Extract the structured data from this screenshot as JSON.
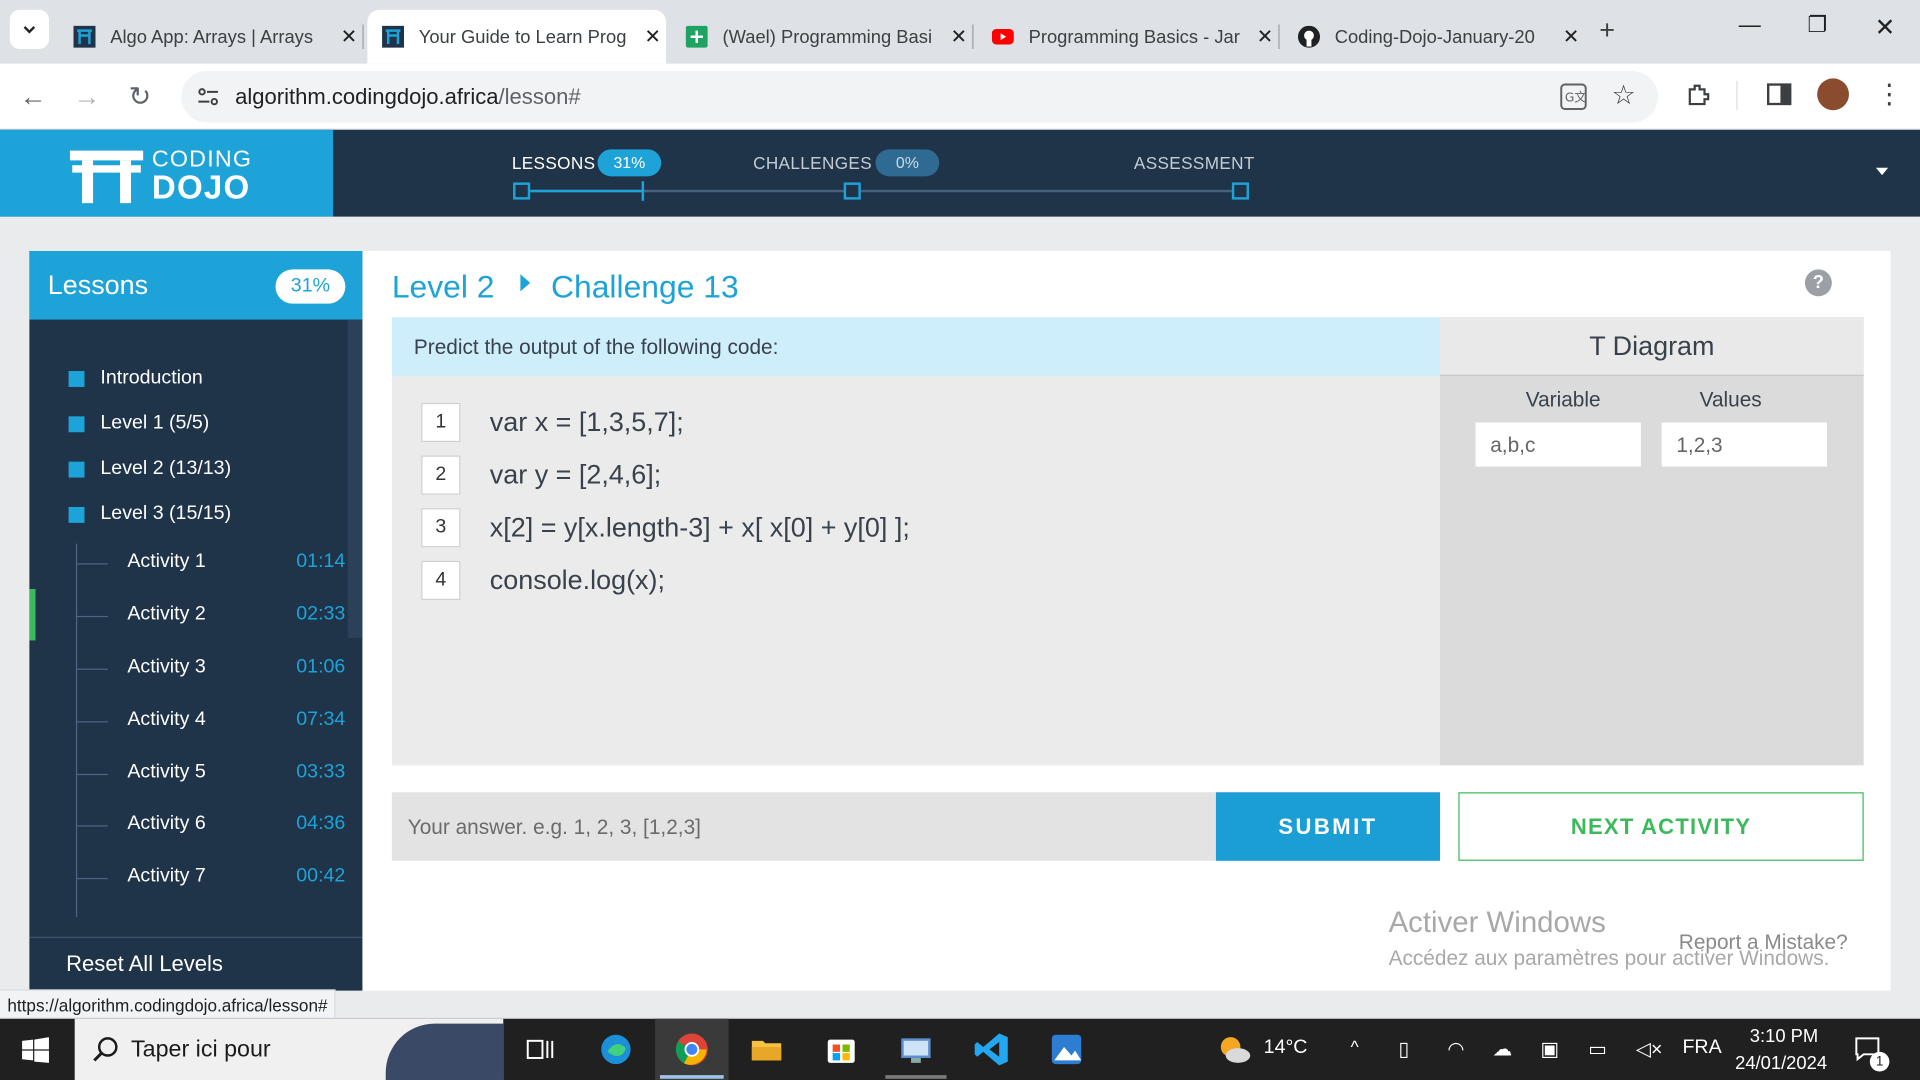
{
  "browser": {
    "tabs": [
      {
        "title": "Algo App: Arrays | Arrays",
        "icon": "coding-dojo-favicon"
      },
      {
        "title": "Your Guide to Learn Prog",
        "icon": "coding-dojo-favicon"
      },
      {
        "title": "(Wael) Programming Basi",
        "icon": "google-sheets-icon"
      },
      {
        "title": "Programming Basics - Jar",
        "icon": "youtube-icon"
      },
      {
        "title": "Coding-Dojo-January-20",
        "icon": "github-icon"
      }
    ],
    "url_host": "algorithm.codingdojo.africa",
    "url_path": "/lesson#",
    "status_url": "https://algorithm.codingdojo.africa/lesson#"
  },
  "site": {
    "logo_top": "CODING",
    "logo_bottom": "DOJO",
    "progress": {
      "lessons_label": "LESSONS",
      "lessons_pct": "31%",
      "challenges_label": "CHALLENGES",
      "challenges_pct": "0%",
      "assessment_label": "ASSESSMENT",
      "lessons_fill_fraction": 0.31
    }
  },
  "sidebar": {
    "title": "Lessons",
    "pct": "31%",
    "sections": [
      {
        "label": "Introduction"
      },
      {
        "label": "Level 1 (5/5)"
      },
      {
        "label": "Level 2 (13/13)"
      },
      {
        "label": "Level 3 (15/15)"
      }
    ],
    "activities": [
      {
        "name": "Activity 1",
        "time": "01:14"
      },
      {
        "name": "Activity 2",
        "time": "02:33"
      },
      {
        "name": "Activity 3",
        "time": "01:06"
      },
      {
        "name": "Activity 4",
        "time": "07:34"
      },
      {
        "name": "Activity 5",
        "time": "03:33"
      },
      {
        "name": "Activity 6",
        "time": "04:36"
      },
      {
        "name": "Activity 7",
        "time": "00:42"
      }
    ],
    "reset_label": "Reset All Levels"
  },
  "challenge": {
    "level": "Level 2",
    "title": "Challenge 13",
    "prompt": "Predict the output of the following code:",
    "code": [
      {
        "num": "1",
        "text": "var x = [1,3,5,7];"
      },
      {
        "num": "2",
        "text": "var y = [2,4,6];"
      },
      {
        "num": "3",
        "text": "x[2] = y[x.length-3] + x[ x[0] + y[0] ];"
      },
      {
        "num": "4",
        "text": "console.log(x);"
      }
    ],
    "tdiagram": {
      "title": "T Diagram",
      "col_variable": "Variable",
      "col_values": "Values",
      "variable_placeholder": "a,b,c",
      "values_placeholder": "1,2,3"
    },
    "answer_placeholder": "Your answer. e.g. 1, 2, 3, [1,2,3]",
    "submit_label": "SUBMIT",
    "next_label": "NEXT ACTIVITY",
    "report_label": "Report a Mistake?"
  },
  "watermark": {
    "line1": "Activer Windows",
    "line2": "Accédez aux paramètres pour activer Windows."
  },
  "taskbar": {
    "search_placeholder": "Taper ici pour",
    "weather": "14°C",
    "lang": "FRA",
    "time": "3:10 PM",
    "date": "24/01/2024",
    "notif_count": "1"
  }
}
